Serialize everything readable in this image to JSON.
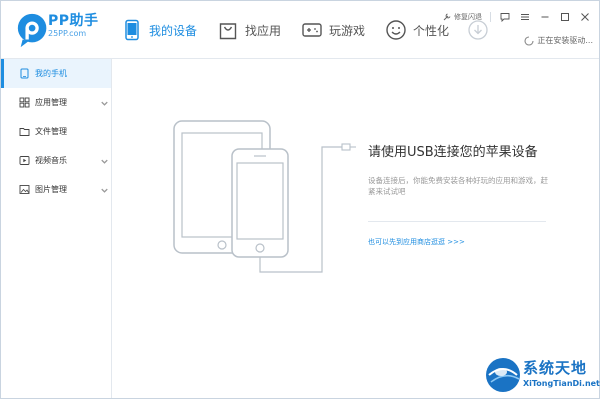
{
  "app": {
    "name": "PP助手",
    "site": "25PP.com"
  },
  "nav": {
    "items": [
      {
        "label": "我的设备",
        "icon": "phone-icon",
        "active": true
      },
      {
        "label": "找应用",
        "icon": "shopping-bag-icon",
        "active": false
      },
      {
        "label": "玩游戏",
        "icon": "gamepad-icon",
        "active": false
      },
      {
        "label": "个性化",
        "icon": "smiley-icon",
        "active": false
      }
    ],
    "download_icon": "download-icon"
  },
  "titlebar": {
    "feedback_label": "修复闪退",
    "buttons": [
      "message-icon",
      "menu-icon",
      "minimize-icon",
      "maximize-icon",
      "close-icon"
    ]
  },
  "status": {
    "install_text": "正在安装驱动..."
  },
  "sidebar": {
    "items": [
      {
        "label": "我的手机",
        "icon": "tablet-icon",
        "active": true,
        "has_children": false
      },
      {
        "label": "应用管理",
        "icon": "grid-icon",
        "active": false,
        "has_children": true
      },
      {
        "label": "文件管理",
        "icon": "folder-icon",
        "active": false,
        "has_children": false
      },
      {
        "label": "视频音乐",
        "icon": "media-icon",
        "active": false,
        "has_children": true
      },
      {
        "label": "图片管理",
        "icon": "image-icon",
        "active": false,
        "has_children": true
      }
    ]
  },
  "main": {
    "title": "请使用USB连接您的苹果设备",
    "description": "设备连接后，你能免费安装各种好玩的应用和游戏，赶紧来试试吧",
    "store_link": "也可以先到应用商店逛逛 >>>"
  },
  "watermark": {
    "title": "系统天地",
    "url": "XiTongTianDi.net"
  },
  "colors": {
    "accent": "#1e8de0",
    "sidebar_active_bg": "#eaf4fd",
    "border": "#e3e8ee",
    "muted_text": "#999999",
    "device_outline": "#b9c1c9"
  }
}
